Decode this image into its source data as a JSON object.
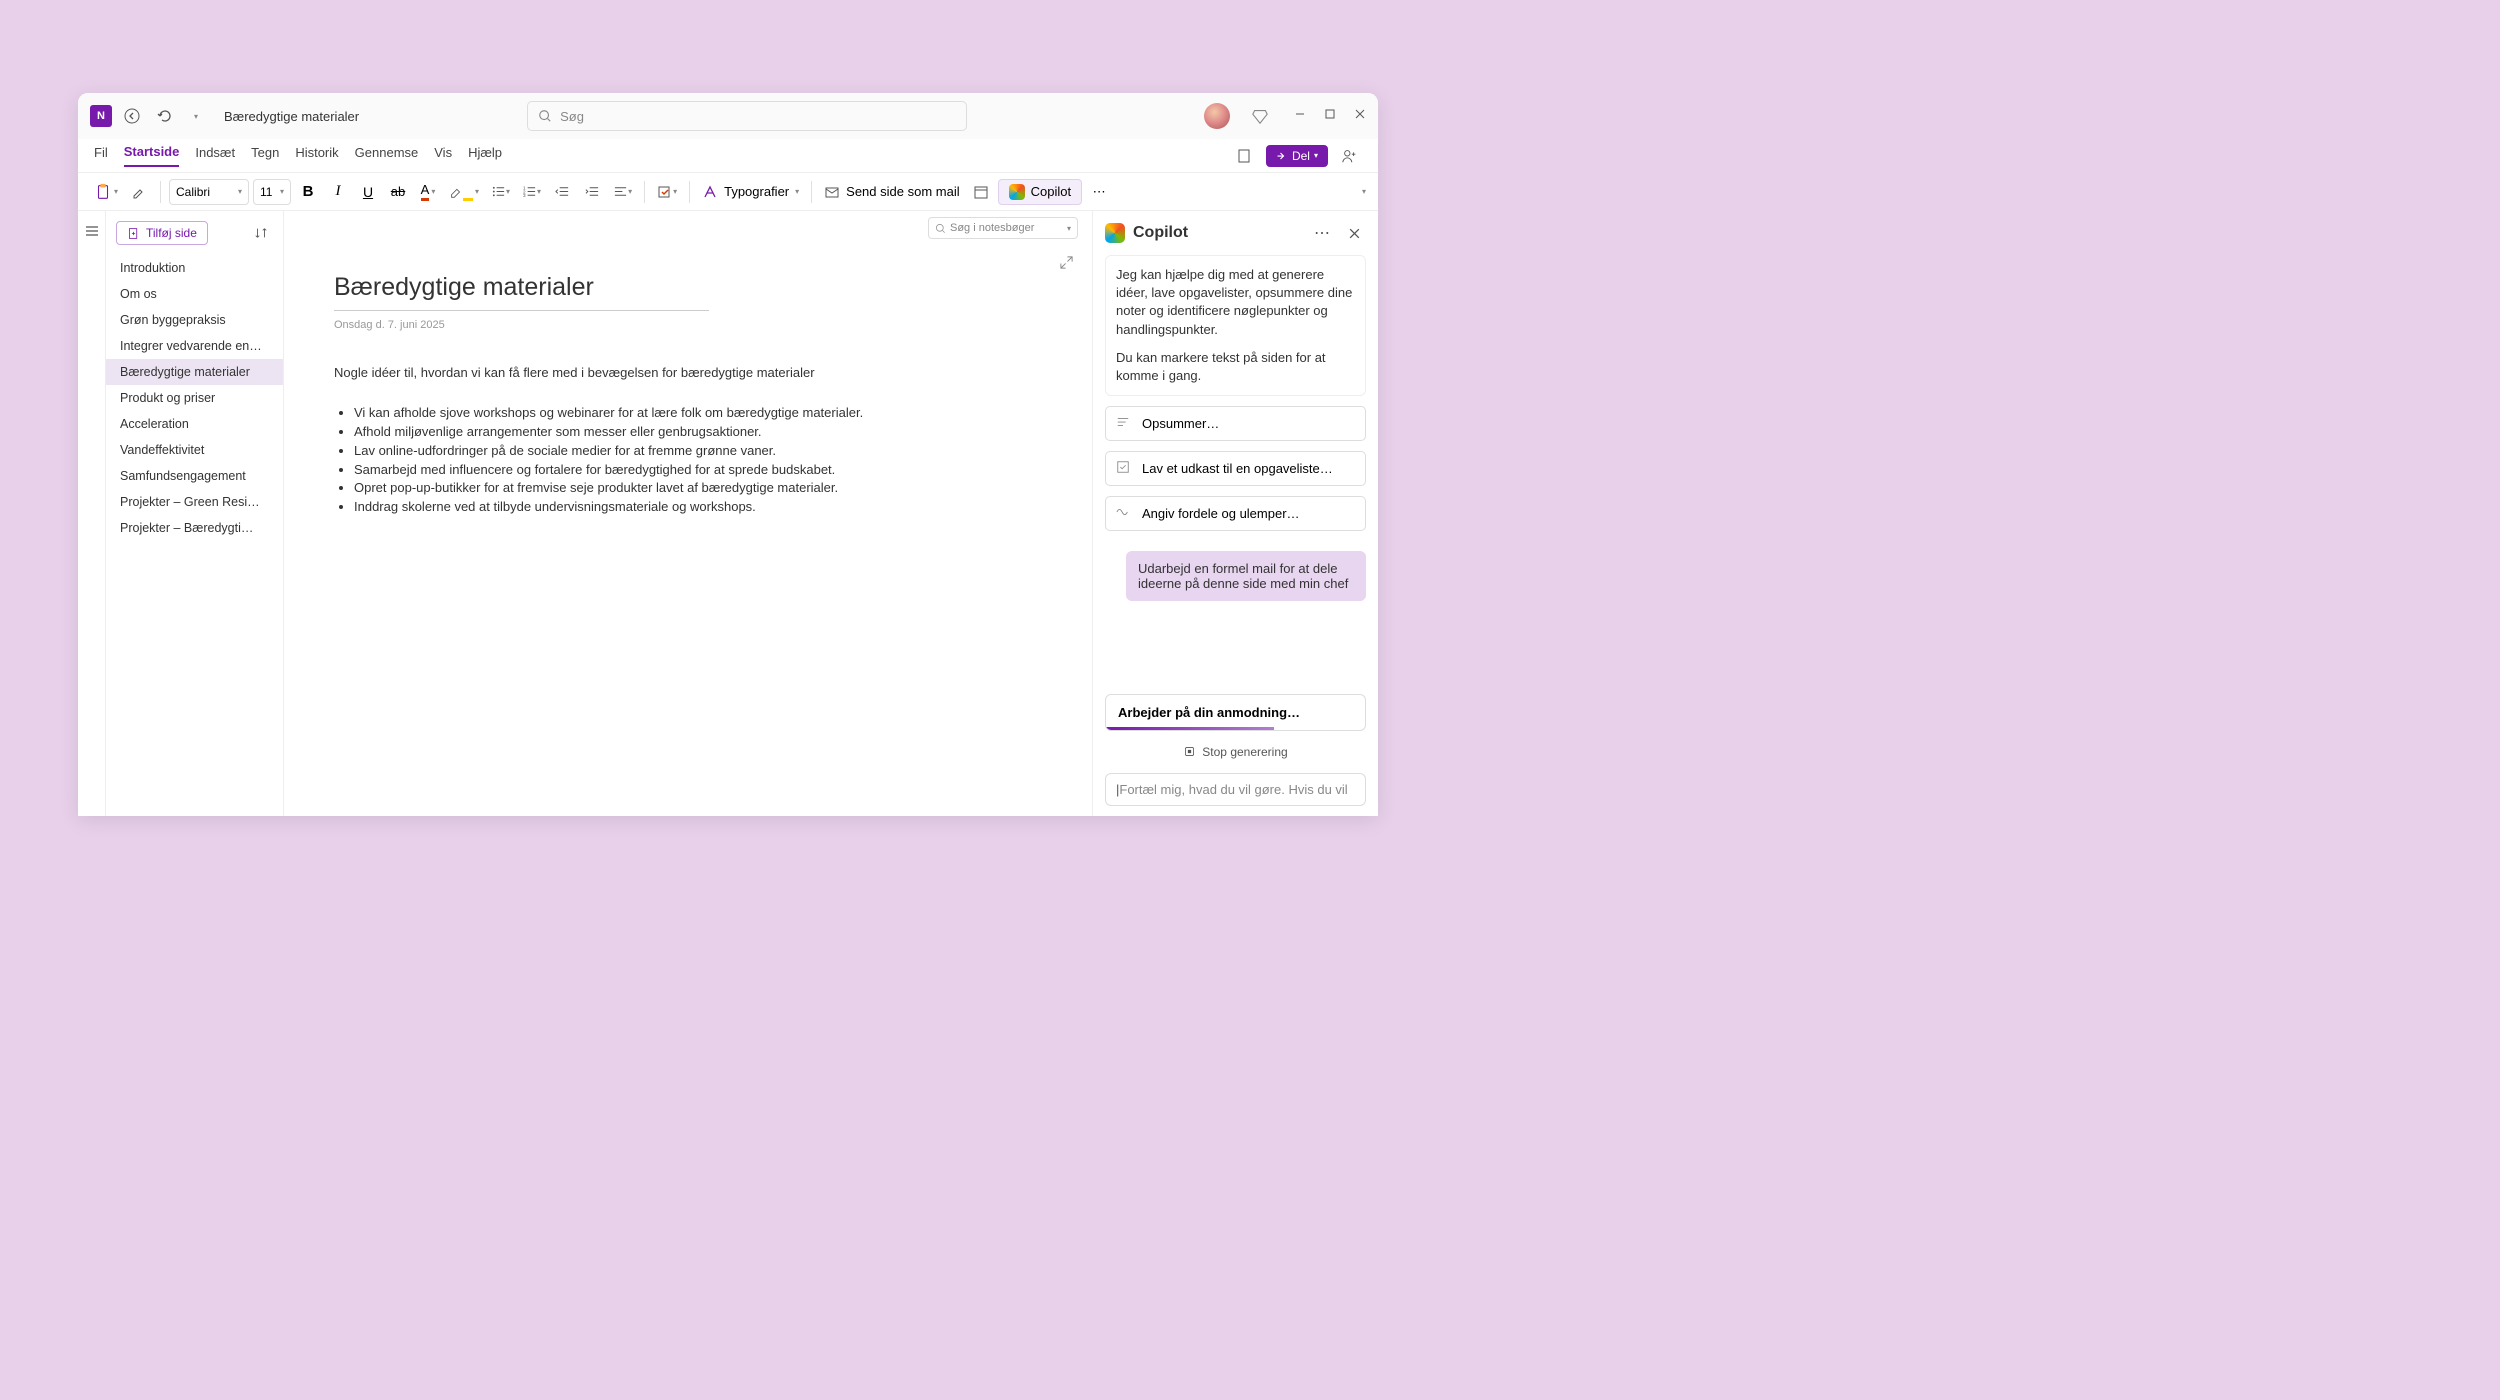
{
  "titlebar": {
    "app_letter": "N",
    "title": "Bæredygtige materialer",
    "search_placeholder": "Søg"
  },
  "menubar": {
    "items": [
      "Fil",
      "Startside",
      "Indsæt",
      "Tegn",
      "Historik",
      "Gennemse",
      "Vis",
      "Hjælp"
    ],
    "active_index": 1,
    "share_label": "Del"
  },
  "ribbon": {
    "font_name": "Calibri",
    "font_size": "11",
    "styles_label": "Typografier",
    "send_mail_label": "Send side som mail",
    "copilot_label": "Copilot"
  },
  "notebook_search_placeholder": "Søg i notesbøger",
  "page_list": {
    "add_label": "Tilføj side",
    "items": [
      "Introduktion",
      "Om os",
      "Grøn byggepraksis",
      "Integrer vedvarende en…",
      "Bæredygtige materialer",
      "Produkt og priser",
      "Acceleration",
      "Vandeffektivitet",
      "Samfundsengagement",
      "Projekter – Green Resi…",
      "Projekter – Bæredygti…"
    ],
    "selected_index": 4
  },
  "note": {
    "title": "Bæredygtige materialer",
    "date": "Onsdag d. 7. juni 2025",
    "intro": "Nogle idéer til, hvordan vi kan få flere med i bevægelsen for bæredygtige materialer",
    "bullets": [
      "Vi kan afholde sjove workshops og webinarer for at lære folk om bæredygtige materialer.",
      "Afhold miljøvenlige arrangementer som messer eller genbrugsaktioner.",
      "Lav online-udfordringer på de sociale medier for at fremme grønne vaner.",
      "Samarbejd med influencere og fortalere for bæredygtighed for at sprede budskabet.",
      "Opret pop-up-butikker for at fremvise seje produkter lavet af bæredygtige materialer.",
      "Inddrag skolerne ved at tilbyde undervisningsmateriale og workshops."
    ]
  },
  "copilot": {
    "title": "Copilot",
    "intro1": "Jeg kan hjælpe dig med at generere idéer, lave opgavelister, opsummere dine noter og identificere nøglepunkter og handlingspunkter.",
    "intro2": "Du kan markere tekst på siden for at komme i gang.",
    "suggestions": [
      "Opsummer…",
      "Lav et udkast til en opgaveliste…",
      "Angiv fordele og ulemper…"
    ],
    "user_message": "Udarbejd en formel mail for at dele ideerne på denne side med min chef",
    "working_label": "Arbejder på din anmodning…",
    "stop_label": "Stop generering",
    "prompt_placeholder": "Fortæl mig, hvad du vil gøre. Hvis du vil"
  }
}
